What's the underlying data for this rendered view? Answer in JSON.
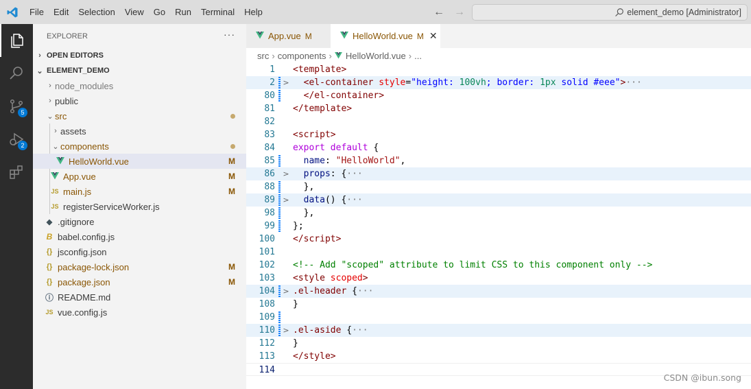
{
  "titlebar": {
    "menu": [
      "File",
      "Edit",
      "Selection",
      "View",
      "Go",
      "Run",
      "Terminal",
      "Help"
    ],
    "search_text": "element_demo [Administrator]"
  },
  "activity": {
    "source_control_badge": "5",
    "run_debug_badge": "2"
  },
  "sidebar": {
    "title": "EXPLORER",
    "more": "···",
    "open_editors": "OPEN EDITORS",
    "project": "ELEMENT_DEMO",
    "items": [
      {
        "label": "node_modules",
        "kind": "folder",
        "status": ""
      },
      {
        "label": "public",
        "kind": "folder",
        "status": ""
      },
      {
        "label": "src",
        "kind": "folder-open",
        "status": "dot"
      },
      {
        "label": "assets",
        "kind": "folder",
        "status": ""
      },
      {
        "label": "components",
        "kind": "folder-open",
        "status": "dot"
      },
      {
        "label": "HelloWorld.vue",
        "kind": "vue",
        "status": "M"
      },
      {
        "label": "App.vue",
        "kind": "vue",
        "status": "M"
      },
      {
        "label": "main.js",
        "kind": "js",
        "status": "M"
      },
      {
        "label": "registerServiceWorker.js",
        "kind": "js",
        "status": ""
      },
      {
        "label": ".gitignore",
        "kind": "git",
        "status": ""
      },
      {
        "label": "babel.config.js",
        "kind": "babel",
        "status": ""
      },
      {
        "label": "jsconfig.json",
        "kind": "json",
        "status": ""
      },
      {
        "label": "package-lock.json",
        "kind": "json",
        "status": "M"
      },
      {
        "label": "package.json",
        "kind": "json",
        "status": "M"
      },
      {
        "label": "README.md",
        "kind": "info",
        "status": ""
      },
      {
        "label": "vue.config.js",
        "kind": "js",
        "status": ""
      }
    ]
  },
  "tabs": [
    {
      "label": "App.vue",
      "status": "M"
    },
    {
      "label": "HelloWorld.vue",
      "status": "M",
      "close": "✕"
    }
  ],
  "breadcrumb": [
    "src",
    "components",
    "HelloWorld.vue",
    "..."
  ],
  "editor": {
    "line_numbers": [
      "1",
      "2",
      "80",
      "81",
      "82",
      "83",
      "84",
      "85",
      "86",
      "88",
      "89",
      "98",
      "99",
      "100",
      "101",
      "102",
      "103",
      "104",
      "108",
      "109",
      "110",
      "112",
      "113",
      "114"
    ]
  },
  "watermark": "CSDN @ibun.song",
  "colors": {
    "accent": "#0078d4",
    "modified": "#895503",
    "activity_bg": "#2c2c2c",
    "sidebar_bg": "#f3f3f3"
  }
}
